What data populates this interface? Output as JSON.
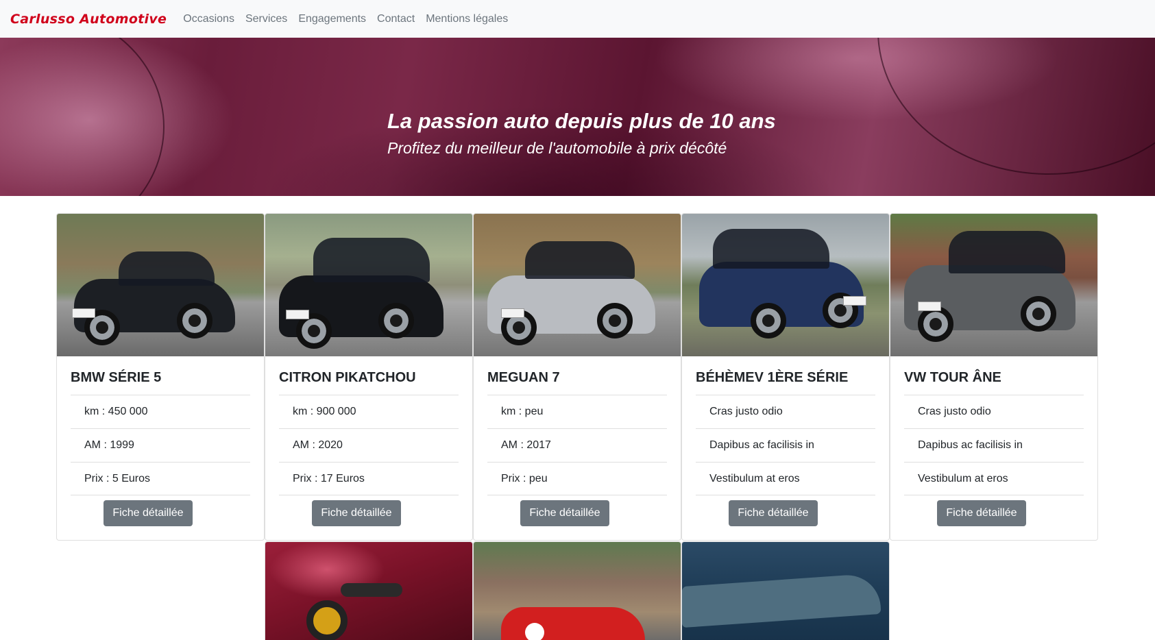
{
  "navbar": {
    "brand": "Carlusso Automotive",
    "links": [
      "Occasions",
      "Services",
      "Engagements",
      "Contact",
      "Mentions légales"
    ]
  },
  "hero": {
    "title": "La passion auto depuis plus de 10 ans",
    "subtitle": "Profitez du meilleur de l'automobile à prix décôté"
  },
  "cards": [
    {
      "title": "BMW SÉRIE 5",
      "items": [
        "km : 450 000",
        "AM : 1999",
        "Prix : 5 Euros"
      ],
      "button": "Fiche détaillée",
      "car_color": "#1c1f24"
    },
    {
      "title": "CITRON PIKATCHOU",
      "items": [
        "km : 900 000",
        "AM : 2020",
        "Prix : 17 Euros"
      ],
      "button": "Fiche détaillée",
      "car_color": "#15171b"
    },
    {
      "title": "MEGUAN 7",
      "items": [
        "km : peu",
        "AM : 2017",
        "Prix : peu"
      ],
      "button": "Fiche détaillée",
      "car_color": "#b9bcc1"
    },
    {
      "title": "BÉHÈMEV 1ÈRE SÉRIE",
      "items": [
        "Cras justo odio",
        "Dapibus ac facilisis in",
        "Vestibulum at eros"
      ],
      "button": "Fiche détaillée",
      "car_color": "#22345e"
    },
    {
      "title": "VW TOUR ÂNE",
      "items": [
        "Cras justo odio",
        "Dapibus ac facilisis in",
        "Vestibulum at eros"
      ],
      "button": "Fiche détaillée",
      "car_color": "#5a5d60"
    }
  ],
  "colors": {
    "brand": "#d0021b",
    "navbar_bg": "#f8f9fa",
    "button_bg": "#6c757d",
    "hero_tint": "#6a1d3b"
  }
}
